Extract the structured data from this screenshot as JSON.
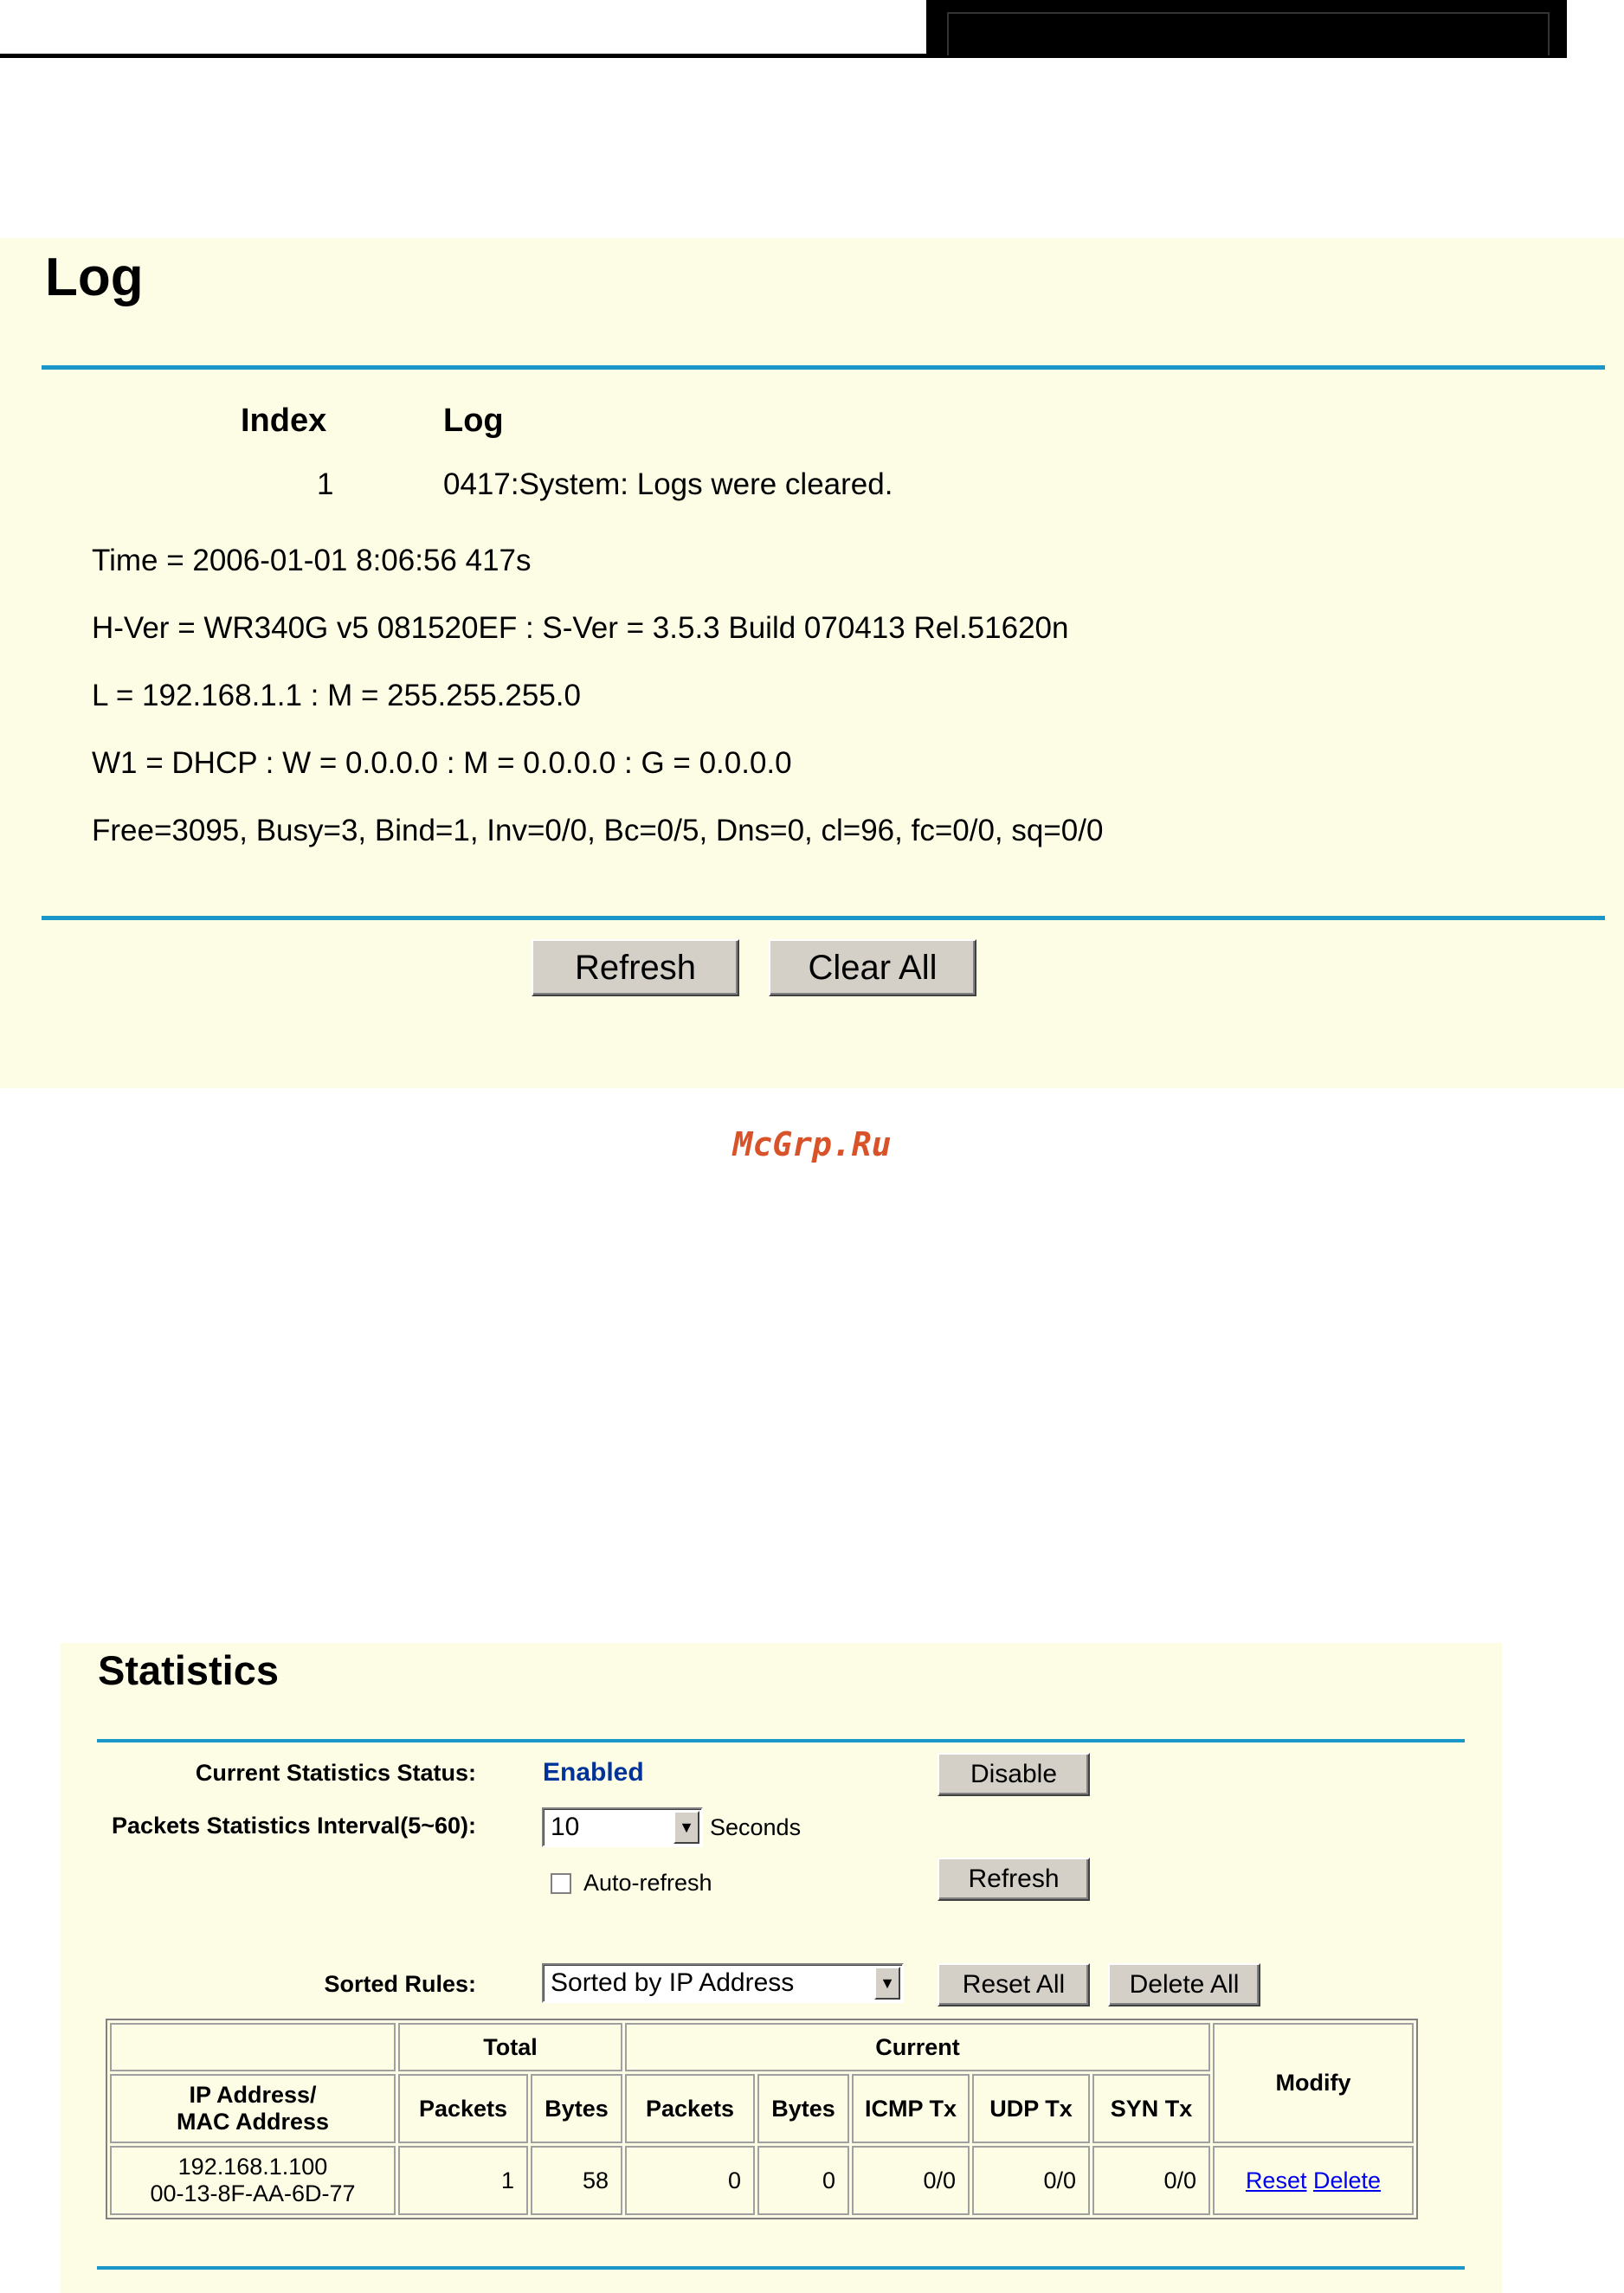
{
  "log": {
    "title": "Log",
    "columns": {
      "index": "Index",
      "log": "Log"
    },
    "entries": [
      {
        "index": "1",
        "text": "0417:System: Logs were cleared."
      }
    ],
    "info": [
      "Time = 2006-01-01 8:06:56 417s",
      "H-Ver = WR340G v5 081520EF : S-Ver = 3.5.3 Build 070413 Rel.51620n",
      "L = 192.168.1.1 : M = 255.255.255.0",
      "W1 = DHCP : W = 0.0.0.0 : M = 0.0.0.0 : G = 0.0.0.0",
      "Free=3095, Busy=3, Bind=1, Inv=0/0, Bc=0/5, Dns=0, cl=96, fc=0/0, sq=0/0"
    ],
    "buttons": {
      "refresh": "Refresh",
      "clear_all": "Clear All"
    }
  },
  "watermark": "McGrp.Ru",
  "statistics": {
    "title": "Statistics",
    "status_label": "Current Statistics Status:",
    "status_value": "Enabled",
    "disable_button": "Disable",
    "interval_label": "Packets Statistics Interval(5~60):",
    "interval_value": "10",
    "interval_unit": "Seconds",
    "auto_refresh_label": "Auto-refresh",
    "refresh_button": "Refresh",
    "sorted_label": "Sorted Rules:",
    "sorted_value": "Sorted by IP Address",
    "reset_all_button": "Reset All",
    "delete_all_button": "Delete All",
    "table": {
      "group_total": "Total",
      "group_current": "Current",
      "modify": "Modify",
      "col_ip_mac_1": "IP Address/",
      "col_ip_mac_2": "MAC Address",
      "col_packets": "Packets",
      "col_bytes": "Bytes",
      "col_cur_packets": "Packets",
      "col_cur_bytes": "Bytes",
      "col_icmp": "ICMP Tx",
      "col_udp": "UDP Tx",
      "col_syn": "SYN Tx",
      "rows": [
        {
          "ip": "192.168.1.100",
          "mac": "00-13-8F-AA-6D-77",
          "packets": "1",
          "bytes": "58",
          "cur_packets": "0",
          "cur_bytes": "0",
          "icmp": "0/0",
          "udp": "0/0",
          "syn": "0/0",
          "reset": "Reset",
          "delete": "Delete"
        }
      ]
    }
  }
}
